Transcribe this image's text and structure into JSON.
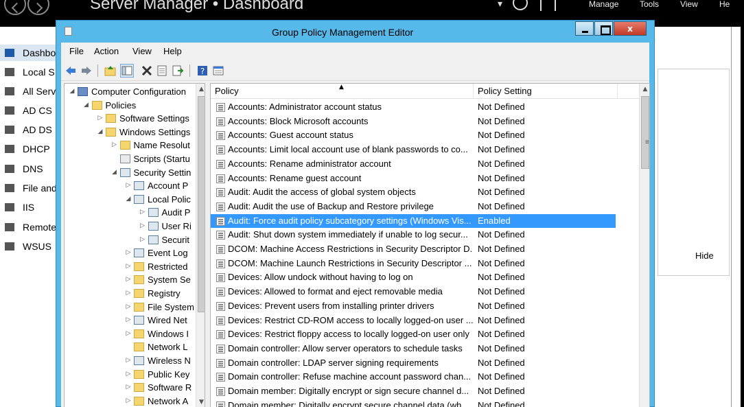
{
  "server_manager": {
    "title": "Server Manager • Dashboard",
    "menu": [
      "Manage",
      "Tools",
      "View",
      "He"
    ],
    "sidebar": [
      {
        "label": "Dashbo",
        "icon": "dashboard-icon",
        "active": true
      },
      {
        "label": "Local S",
        "icon": "local-server-icon"
      },
      {
        "label": "All Serv",
        "icon": "all-servers-icon"
      },
      {
        "label": "AD CS",
        "icon": "ad-cs-icon"
      },
      {
        "label": "AD DS",
        "icon": "ad-ds-icon"
      },
      {
        "label": "DHCP",
        "icon": "dhcp-icon"
      },
      {
        "label": "DNS",
        "icon": "dns-icon"
      },
      {
        "label": "File and",
        "icon": "file-services-icon"
      },
      {
        "label": "IIS",
        "icon": "iis-icon"
      },
      {
        "label": "Remote",
        "icon": "remote-access-icon"
      },
      {
        "label": "WSUS",
        "icon": "wsus-icon"
      }
    ],
    "hide_label": "Hide"
  },
  "window": {
    "title": "Group Policy Management Editor",
    "close_glyph": "x"
  },
  "menubar": [
    "File",
    "Action",
    "View",
    "Help"
  ],
  "toolbar": [
    "back-icon",
    "forward-icon",
    "up-folder-icon",
    "show-hide-tree-icon",
    "delete-icon",
    "properties-icon",
    "export-list-icon",
    "help-icon",
    "show-hide-pane-icon"
  ],
  "tree": {
    "nodes": [
      {
        "label": "Computer Configuration",
        "expander": "◢",
        "icon": "comp"
      },
      {
        "label": "Policies",
        "expander": "◢",
        "icon": "folder"
      },
      {
        "label": "Software Settings",
        "expander": "▷",
        "icon": "folder"
      },
      {
        "label": "Windows Settings",
        "expander": "◢",
        "icon": "folder"
      },
      {
        "label": "Name Resolut",
        "expander": "▷",
        "icon": "folder"
      },
      {
        "label": "Scripts (Startu",
        "expander": "",
        "icon": "doc"
      },
      {
        "label": "Security Settin",
        "expander": "◢",
        "icon": "sec"
      },
      {
        "label": "Account P",
        "expander": "▷",
        "icon": "sec"
      },
      {
        "label": "Local Polic",
        "expander": "◢",
        "icon": "sec"
      },
      {
        "label": "Audit P",
        "expander": "▷",
        "icon": "sec"
      },
      {
        "label": "User Ri",
        "expander": "▷",
        "icon": "sec"
      },
      {
        "label": "Securit",
        "expander": "▷",
        "icon": "sec"
      },
      {
        "label": "Event Log",
        "expander": "▷",
        "icon": "sec"
      },
      {
        "label": "Restricted",
        "expander": "▷",
        "icon": "folder"
      },
      {
        "label": "System Se",
        "expander": "▷",
        "icon": "folder"
      },
      {
        "label": "Registry",
        "expander": "▷",
        "icon": "folder"
      },
      {
        "label": "File System",
        "expander": "▷",
        "icon": "folder"
      },
      {
        "label": "Wired Net",
        "expander": "▷",
        "icon": "sec"
      },
      {
        "label": "Windows I",
        "expander": "▷",
        "icon": "folder"
      },
      {
        "label": "Network L",
        "expander": "",
        "icon": "folder"
      },
      {
        "label": "Wireless N",
        "expander": "▷",
        "icon": "sec"
      },
      {
        "label": "Public Key",
        "expander": "▷",
        "icon": "folder"
      },
      {
        "label": "Software R",
        "expander": "▷",
        "icon": "folder"
      },
      {
        "label": "Network A",
        "expander": "▷",
        "icon": "folder"
      }
    ]
  },
  "list": {
    "columns": {
      "policy": "Policy",
      "setting": "Policy Setting"
    },
    "rows": [
      {
        "policy": "Accounts: Administrator account status",
        "setting": "Not Defined"
      },
      {
        "policy": "Accounts: Block Microsoft accounts",
        "setting": "Not Defined"
      },
      {
        "policy": "Accounts: Guest account status",
        "setting": "Not Defined"
      },
      {
        "policy": "Accounts: Limit local account use of blank passwords to co...",
        "setting": "Not Defined"
      },
      {
        "policy": "Accounts: Rename administrator account",
        "setting": "Not Defined"
      },
      {
        "policy": "Accounts: Rename guest account",
        "setting": "Not Defined"
      },
      {
        "policy": "Audit: Audit the access of global system objects",
        "setting": "Not Defined"
      },
      {
        "policy": "Audit: Audit the use of Backup and Restore privilege",
        "setting": "Not Defined"
      },
      {
        "policy": "Audit: Force audit policy subcategory settings (Windows Vis...",
        "setting": "Enabled",
        "selected": true
      },
      {
        "policy": "Audit: Shut down system immediately if unable to log secur...",
        "setting": "Not Defined"
      },
      {
        "policy": "DCOM: Machine Access Restrictions in Security Descriptor D...",
        "setting": "Not Defined"
      },
      {
        "policy": "DCOM: Machine Launch Restrictions in Security Descriptor ...",
        "setting": "Not Defined"
      },
      {
        "policy": "Devices: Allow undock without having to log on",
        "setting": "Not Defined"
      },
      {
        "policy": "Devices: Allowed to format and eject removable media",
        "setting": "Not Defined"
      },
      {
        "policy": "Devices: Prevent users from installing printer drivers",
        "setting": "Not Defined"
      },
      {
        "policy": "Devices: Restrict CD-ROM access to locally logged-on user ...",
        "setting": "Not Defined"
      },
      {
        "policy": "Devices: Restrict floppy access to locally logged-on user only",
        "setting": "Not Defined"
      },
      {
        "policy": "Domain controller: Allow server operators to schedule tasks",
        "setting": "Not Defined"
      },
      {
        "policy": "Domain controller: LDAP server signing requirements",
        "setting": "Not Defined"
      },
      {
        "policy": "Domain controller: Refuse machine account password chan...",
        "setting": "Not Defined"
      },
      {
        "policy": "Domain member: Digitally encrypt or sign secure channel d...",
        "setting": "Not Defined"
      },
      {
        "policy": "Domain member: Digitally encrypt secure channel data (wh...",
        "setting": "Not Defined"
      }
    ]
  },
  "colors": {
    "accent": "#57b8ea",
    "selection": "#3399ff",
    "close": "#c7432e"
  }
}
